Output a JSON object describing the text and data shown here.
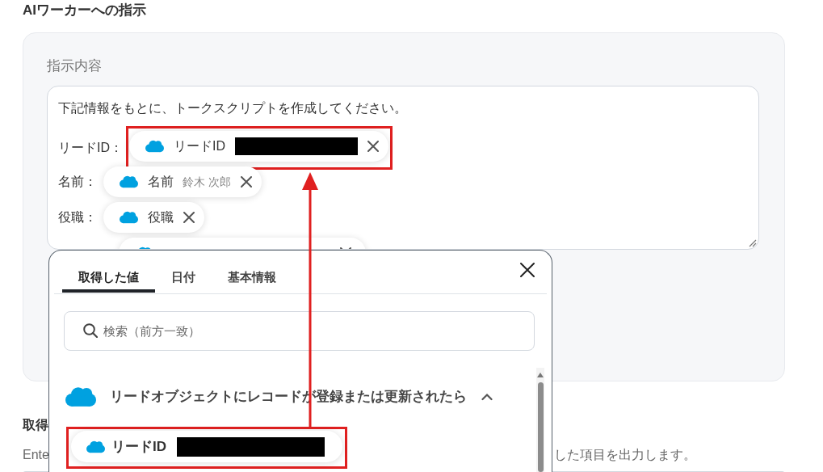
{
  "section": {
    "title": "AIワーカーへの指示"
  },
  "instruction": {
    "label": "指示内容",
    "lines": [
      {
        "kind": "text",
        "text": "下記情報をもとに、トークスクリプトを作成してください。"
      },
      {
        "kind": "field",
        "label": "リードID：",
        "chip": {
          "label": "リードID",
          "redacted": true,
          "highlighted": true
        }
      },
      {
        "kind": "field",
        "label": "名前：",
        "chip": {
          "label": "名前",
          "value": "鈴木 次郎",
          "redacted": false,
          "highlighted": false
        }
      },
      {
        "kind": "field",
        "label": "役職：",
        "chip": {
          "label": "役職",
          "redacted": false,
          "highlighted": false
        }
      },
      {
        "kind": "cut_field"
      }
    ]
  },
  "picker": {
    "tabs": [
      {
        "label": "取得した値",
        "selected": true
      },
      {
        "label": "日付",
        "selected": false
      },
      {
        "label": "基本情報",
        "selected": false
      }
    ],
    "search": {
      "placeholder": "検索（前方一致）"
    },
    "groups": [
      {
        "title": "リードオブジェクトにレコードが登録または更新されたら",
        "expanded": true,
        "items": [
          {
            "label": "リードID",
            "redacted": true,
            "highlighted": true
          }
        ]
      }
    ]
  },
  "output_section": {
    "title": "取得",
    "description_start": "Ente",
    "description_end": "した項目を出力します。"
  }
}
